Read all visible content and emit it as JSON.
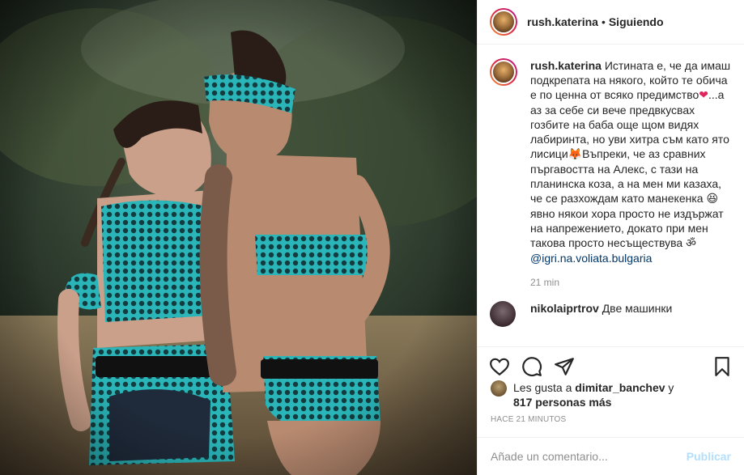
{
  "post": {
    "username": "rush.katerina",
    "separator": "•",
    "follow_status": "Siguiendo",
    "photo_icon": "post-photo"
  },
  "caption": {
    "user": "rush.katerina",
    "text_part1": "Истината е, че да имаш подкрепата на някого, който те обича е по ценна от всяко предимство",
    "heart": "❤",
    "text_part2": "...а аз за себе си вече предвкусвах гозбите на баба още щом видях лабиринта, но уви хитра съм като ято лисици",
    "fox": "🦊",
    "text_part3": "Въпреки, че аз сравних пъргавостта на Алекс, с тази на планинска коза, а на мен ми казаха, че се разхождам като манекенка",
    "laugh": "😆",
    "text_part4": " явно някои хора просто не издържат на напрежението, докато при мен такова просто несъществува ",
    "om": "ॐ",
    "mention": "@igri.na.voliata.bulgaria",
    "time": "21 min"
  },
  "comment2": {
    "user": "nikolaiprtrov",
    "text": "Две машинки"
  },
  "actions": {
    "like_icon": "heart-icon",
    "comment_icon": "comment-icon",
    "share_icon": "share-icon",
    "save_icon": "bookmark-icon"
  },
  "likes": {
    "prefix": "Les gusta a ",
    "user": "dimitar_banchev",
    "mid": " y",
    "count": "817 personas más"
  },
  "timestamp": "HACE 21 MINUTOS",
  "add_comment": {
    "placeholder": "Añade un comentario...",
    "publish": "Publicar"
  },
  "colors": {
    "link": "#00376b",
    "muted": "#8e8e8e",
    "publish_disabled": "#b2dffc",
    "heart": "#e0245e"
  }
}
